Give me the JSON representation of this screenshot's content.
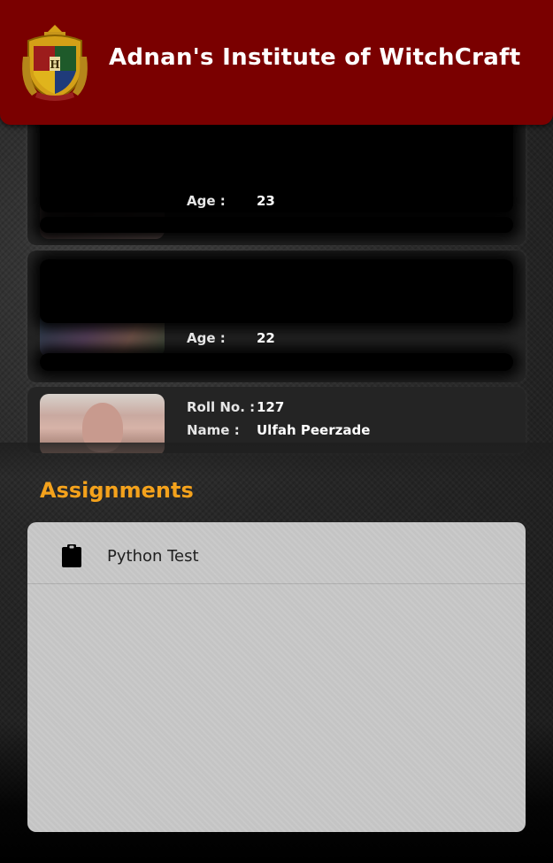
{
  "header": {
    "title": "Adnan's Institute of WitchCraft",
    "logo_icon": "hogwarts-crest-icon"
  },
  "students": [
    {
      "age_label": "Age :",
      "age": "23"
    },
    {
      "age_label": "Age :",
      "age": "22"
    },
    {
      "roll_label": "Roll No. :",
      "roll": "127",
      "name_label": "Name :",
      "name": "Ulfah Peerzade"
    }
  ],
  "assignments": {
    "title": "Assignments",
    "items": [
      {
        "label": "Python Test",
        "icon": "clipboard-icon"
      }
    ]
  },
  "colors": {
    "header_bg": "#7a0000",
    "accent": "#f4a21c",
    "panel_bg": "#c4c4c4"
  }
}
